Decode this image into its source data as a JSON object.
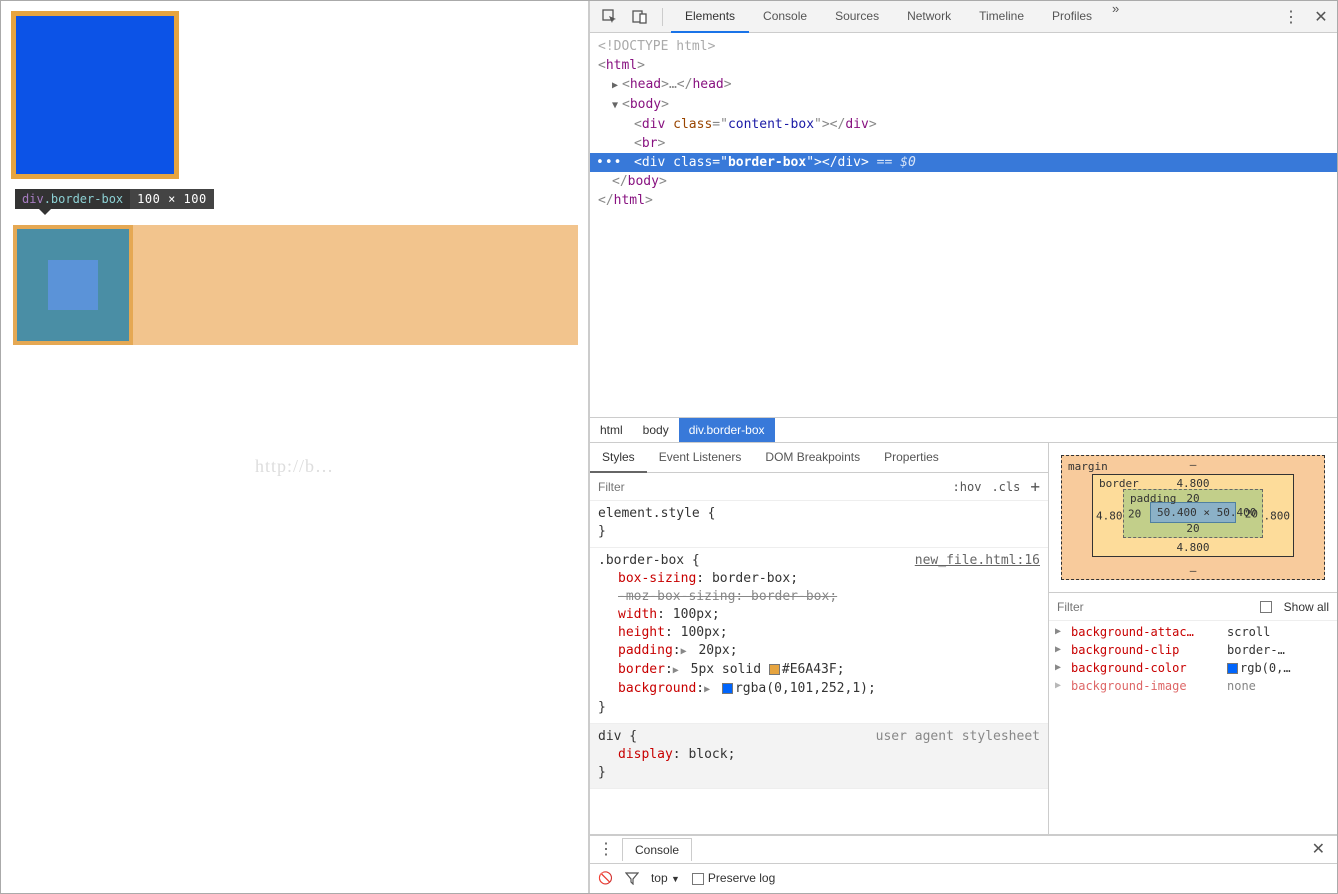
{
  "tooltip": {
    "tag": "div",
    "class": ".border-box",
    "dim": "100 × 100"
  },
  "watermark": "http://b…",
  "toolbar_tabs": [
    "Elements",
    "Console",
    "Sources",
    "Network",
    "Timeline",
    "Profiles"
  ],
  "toolbar_more": "»",
  "dom": {
    "doctype": "<!DOCTYPE html>",
    "selected_eq": "== $0"
  },
  "breadcrumb": [
    "html",
    "body",
    "div.border-box"
  ],
  "sub_tabs": [
    "Styles",
    "Event Listeners",
    "DOM Breakpoints",
    "Properties"
  ],
  "filter_placeholder": "Filter",
  "filter_tools": {
    "hov": ":hov",
    "cls": ".cls"
  },
  "rules": {
    "element_style": "element.style {",
    "border_box_selector": ".border-box {",
    "border_box_src": "new_file.html:16",
    "decls": {
      "box_sizing": {
        "prop": "box-sizing",
        "val": "border-box;"
      },
      "moz": "-moz-box-sizing: border-box;",
      "width": {
        "prop": "width",
        "val": "100px;"
      },
      "height": {
        "prop": "height",
        "val": "100px;"
      },
      "padding": {
        "prop": "padding",
        "val": "20px;"
      },
      "border": {
        "prop": "border",
        "val": "5px solid ",
        "hex": "#E6A43F;"
      },
      "background": {
        "prop": "background",
        "val": "rgba(0,101,252,1);"
      }
    },
    "div_selector": "div {",
    "div_src": "user agent stylesheet",
    "display": {
      "prop": "display",
      "val": "block;"
    }
  },
  "boxmodel": {
    "margin_label": "margin",
    "border_label": "border",
    "padding_label": "padding",
    "margin": {
      "top": "–",
      "bottom": "–"
    },
    "border": {
      "top": "4.800",
      "right": "4.800",
      "bottom": "4.800",
      "left": "4.800"
    },
    "padding": {
      "top": "20",
      "right": "20",
      "bottom": "20",
      "left": "20"
    },
    "content": "50.400 × 50.400"
  },
  "computed_filter": "Filter",
  "show_all": "Show all",
  "computed": [
    {
      "prop": "background-attac…",
      "val": "scroll"
    },
    {
      "prop": "background-clip",
      "val": "border-…"
    },
    {
      "prop": "background-color",
      "val": "rgb(0,…",
      "swatch": "#0065fc"
    },
    {
      "prop": "background-image",
      "val": "none"
    }
  ],
  "drawer": {
    "tab": "Console",
    "top": "top",
    "preserve": "Preserve log"
  }
}
